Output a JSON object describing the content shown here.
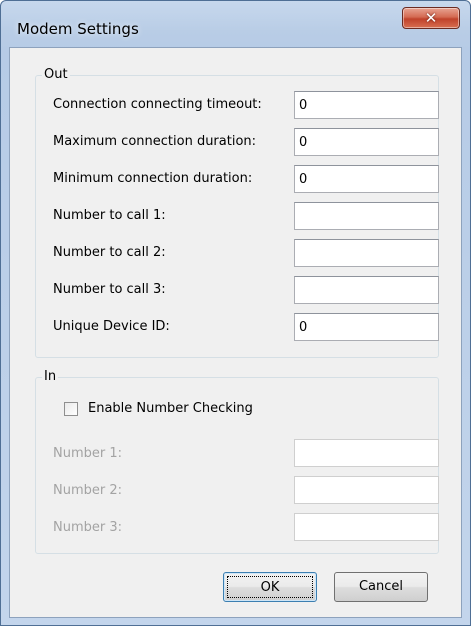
{
  "window": {
    "title": "Modem Settings"
  },
  "title_bar": {
    "close_glyph": "✕",
    "close_icon": "close-icon"
  },
  "out_group": {
    "legend": "Out",
    "rows": [
      {
        "label": "Connection connecting timeout:",
        "value": "0"
      },
      {
        "label": "Maximum connection duration:",
        "value": "0"
      },
      {
        "label": "Minimum connection duration:",
        "value": "0"
      },
      {
        "label": "Number to call 1:",
        "value": ""
      },
      {
        "label": "Number to call 2:",
        "value": ""
      },
      {
        "label": "Number to call 3:",
        "value": ""
      },
      {
        "label": "Unique Device ID:",
        "value": "0"
      }
    ]
  },
  "in_group": {
    "legend": "In",
    "checkbox_label": "Enable Number Checking",
    "checkbox_checked": false,
    "rows": [
      {
        "label": "Number 1:",
        "value": ""
      },
      {
        "label": "Number 2:",
        "value": ""
      },
      {
        "label": "Number 3:",
        "value": ""
      }
    ]
  },
  "buttons": {
    "ok": "OK",
    "cancel": "Cancel"
  },
  "colors": {
    "frame": "#b9cde6",
    "client": "#f0f0f0",
    "close": "#c7472f",
    "disabled_text": "#a3a3a3"
  }
}
